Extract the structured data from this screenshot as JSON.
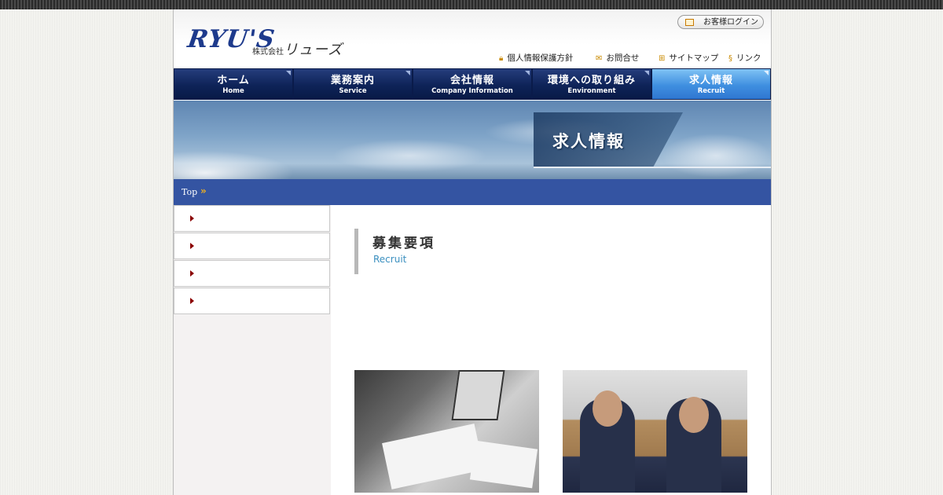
{
  "header": {
    "logo_main": "RYU'S",
    "logo_sub_small": "株式会社",
    "logo_sub_big": "リューズ",
    "login_label": "お客様ログイン",
    "util_links": [
      "個人情報保護方針",
      "お問合せ",
      "サイトマップ",
      "リンク"
    ]
  },
  "nav": [
    {
      "jp": "ホーム",
      "en": "Home"
    },
    {
      "jp": "業務案内",
      "en": "Service"
    },
    {
      "jp": "会社情報",
      "en": "Company Information"
    },
    {
      "jp": "環境への取り組み",
      "en": "Environment"
    },
    {
      "jp": "求人情報",
      "en": "Recruit"
    }
  ],
  "nav_active_index": 4,
  "banner": {
    "title": "求人情報"
  },
  "breadcrumb": {
    "home": "Top",
    "separator": "»"
  },
  "sidebar": {
    "items": [
      "",
      "",
      "",
      ""
    ]
  },
  "main": {
    "title": "募集要項",
    "subtitle": "Recruit"
  },
  "icons": {
    "lock": "lock-icon",
    "mail": "mail-icon",
    "sitemap": "sitemap-icon",
    "link": "link-icon",
    "login": "window-icon"
  },
  "colors": {
    "nav_dark": "#0e2358",
    "nav_active": "#3f8fe0",
    "breadcrumb_bar": "#3454a2",
    "subtitle": "#3a8fbf",
    "sidebar_arrow": "#8b0000"
  }
}
